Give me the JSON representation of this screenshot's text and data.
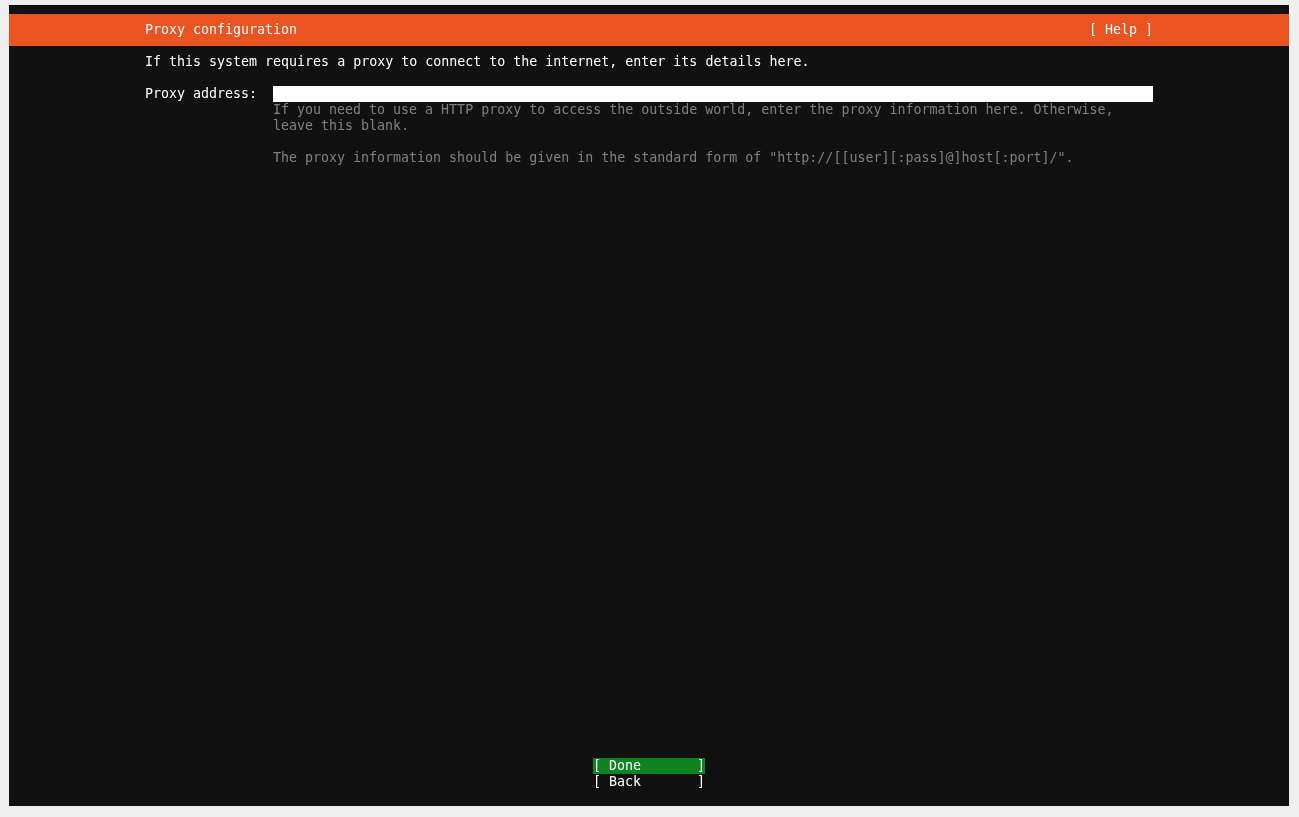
{
  "header": {
    "title": "Proxy configuration",
    "help_button": "[ Help ]"
  },
  "intro": "If this system requires a proxy to connect to the internet, enter its details here.",
  "fields": [
    {
      "label": "Proxy address:",
      "help": [
        "If you need to use a HTTP proxy to access the outside world, enter the proxy information here. Otherwise, leave this blank.",
        "The proxy information should be given in the standard form of \"http://[[user][:pass]@]host[:port]/\"."
      ]
    }
  ],
  "buttons": [
    {
      "label": "[ Done       ]",
      "selected": true
    },
    {
      "label": "[ Back       ]",
      "selected": false
    }
  ]
}
